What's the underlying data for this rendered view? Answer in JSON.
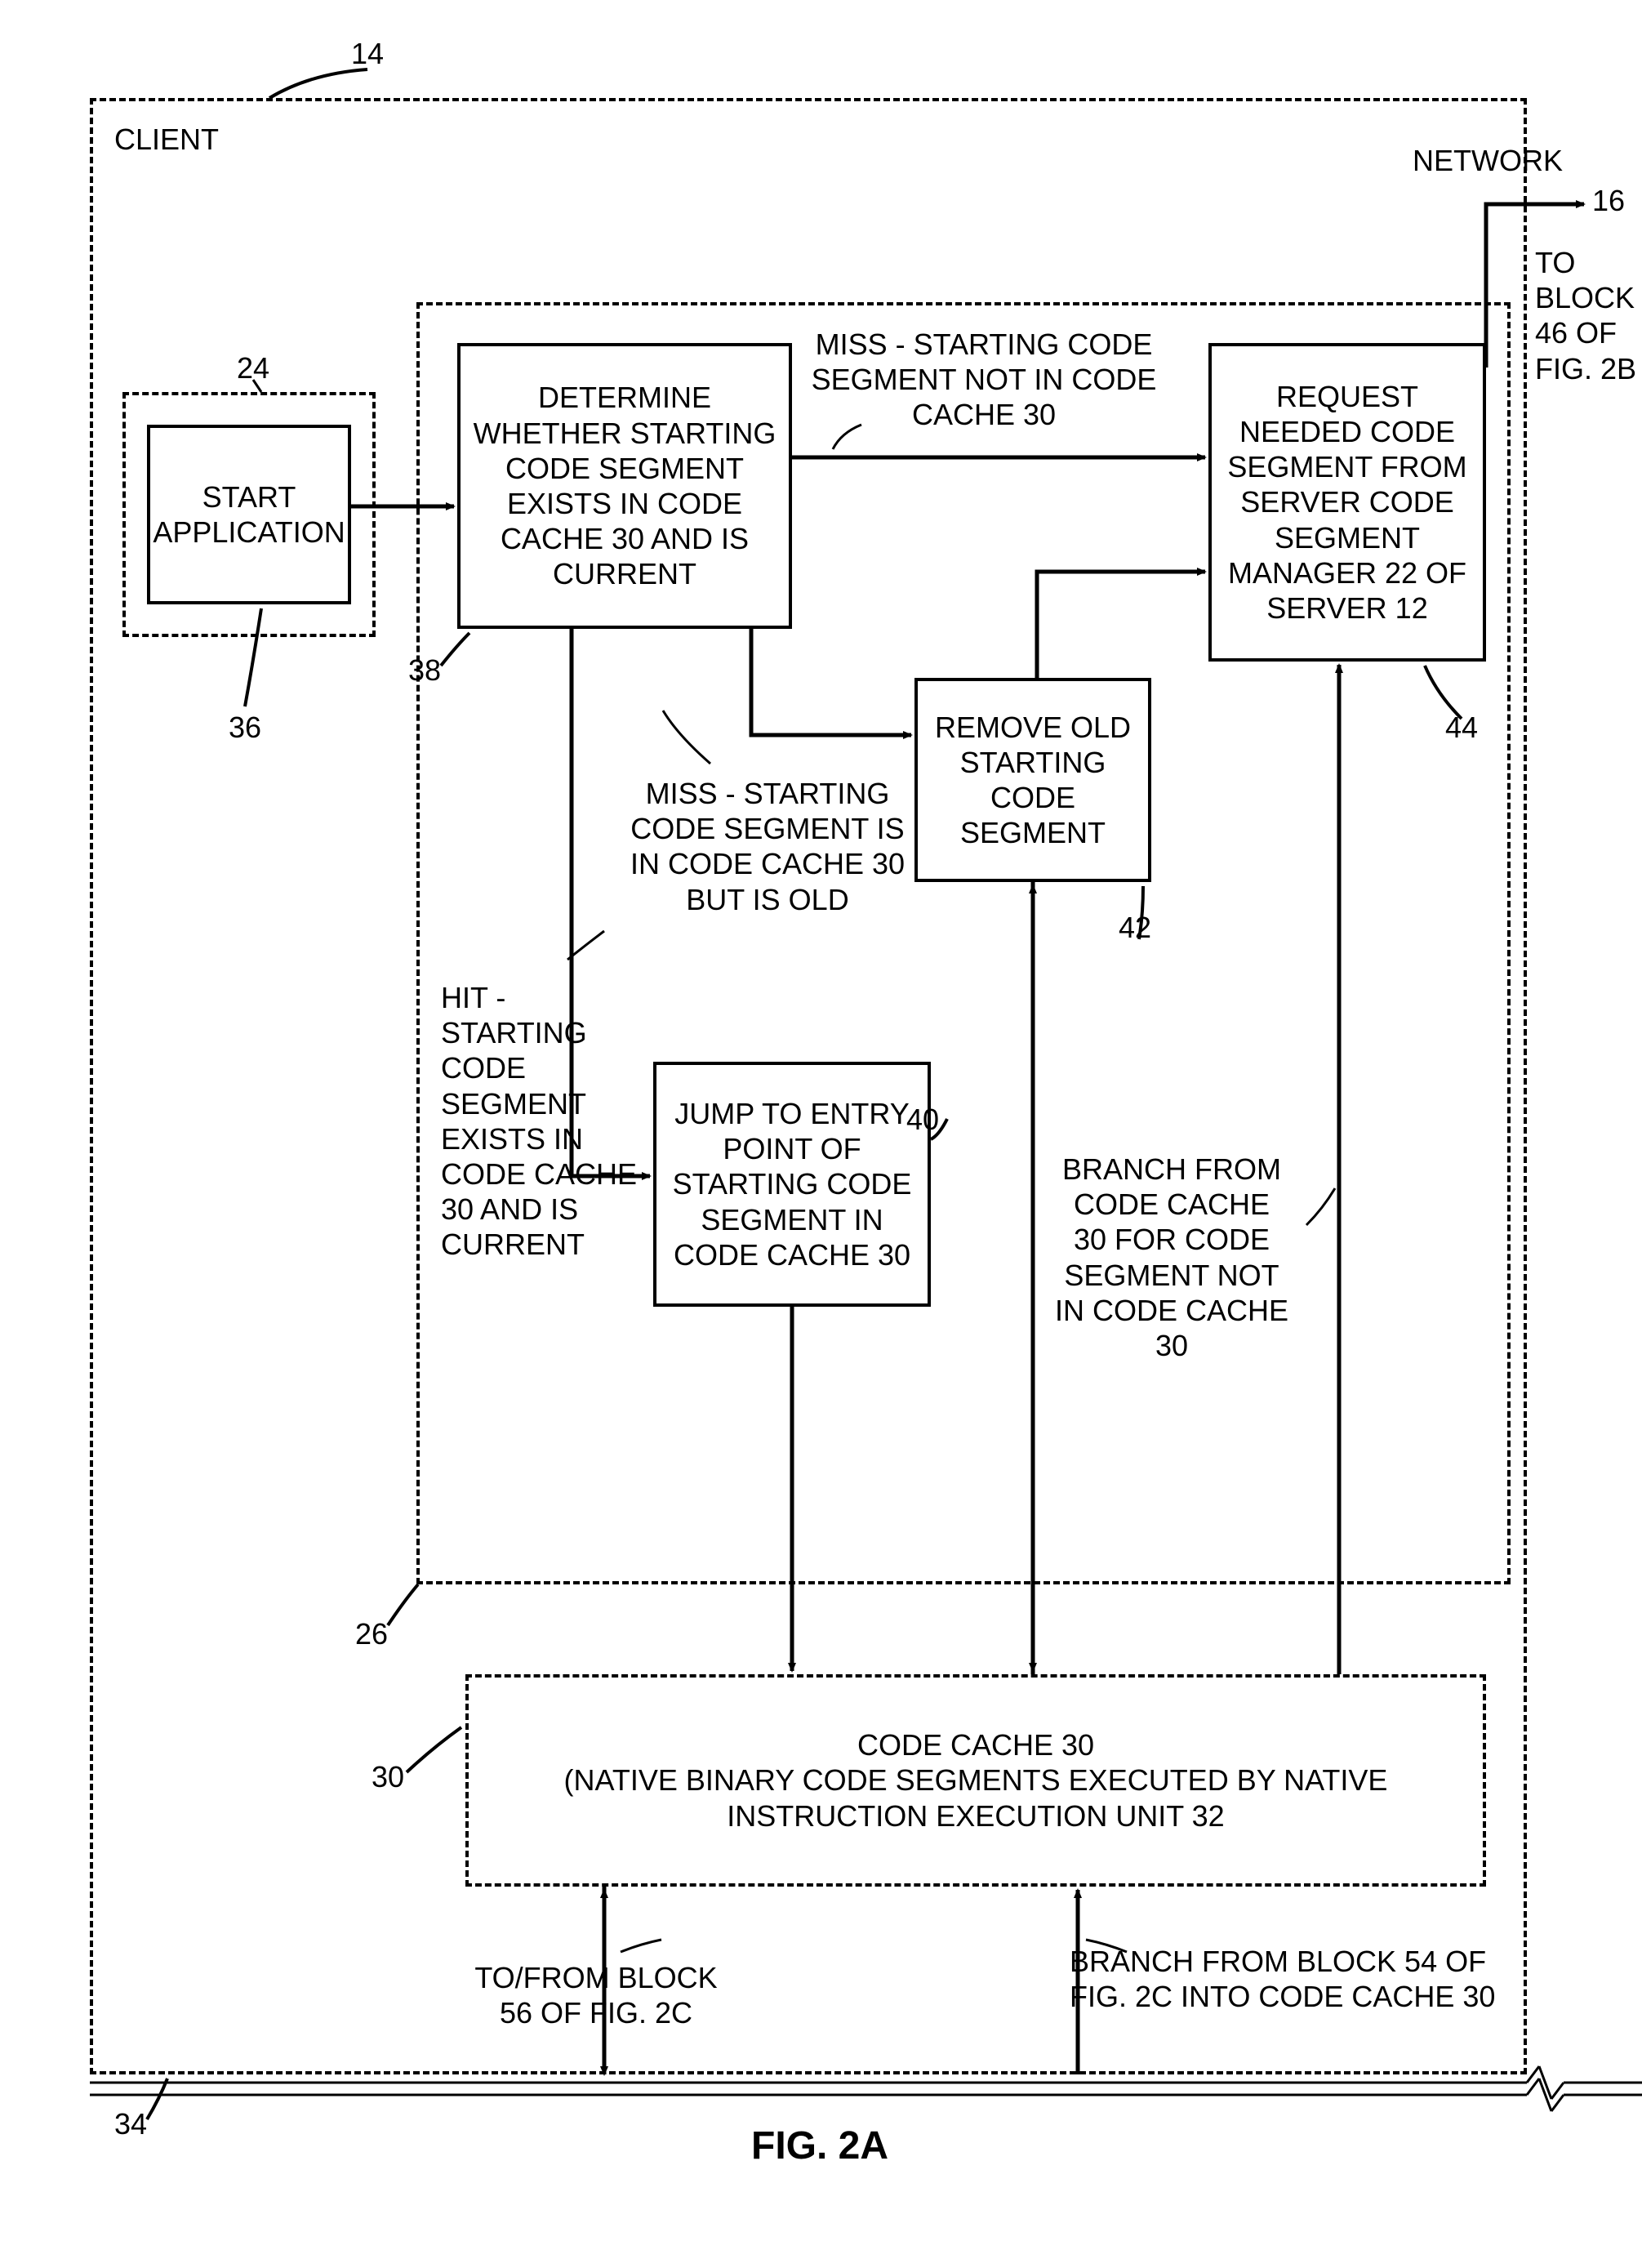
{
  "outer": {
    "title": "CLIENT",
    "ref": "14"
  },
  "startApp": {
    "text": "START\nAPPLICATION",
    "ref": "36",
    "containerRef": "24"
  },
  "mgrBox": {
    "ref": "26"
  },
  "determine": {
    "text": "DETERMINE WHETHER STARTING CODE SEGMENT EXISTS IN CODE CACHE 30 AND IS CURRENT",
    "ref": "38"
  },
  "request": {
    "text": "REQUEST NEEDED CODE SEGMENT FROM SERVER CODE SEGMENT MANAGER 22 OF SERVER 12",
    "ref": "44"
  },
  "remove": {
    "text": "REMOVE OLD STARTING CODE SEGMENT",
    "ref": "42"
  },
  "jump": {
    "text": "JUMP TO ENTRY POINT OF STARTING CODE SEGMENT IN CODE CACHE 30",
    "ref": "40"
  },
  "cache": {
    "text": "CODE CACHE 30\n(NATIVE BINARY CODE SEGMENTS EXECUTED BY NATIVE INSTRUCTION EXECUTION UNIT 32",
    "ref": "30"
  },
  "edges": {
    "missNotIn": "MISS - STARTING CODE SEGMENT NOT IN CODE CACHE 30",
    "missOld": "MISS - STARTING CODE SEGMENT IS IN CODE CACHE 30 BUT IS OLD",
    "hit": "HIT - STARTING CODE SEGMENT EXISTS IN CODE CACHE 30 AND IS CURRENT",
    "branchNotIn": "BRANCH FROM CODE CACHE 30 FOR CODE SEGMENT NOT IN CODE CACHE 30"
  },
  "external": {
    "network": "NETWORK",
    "networkRef": "16",
    "toBlock46": "TO BLOCK\n46 OF\nFIG. 2B",
    "branchFrom54": "BRANCH FROM BLOCK 54 OF\nFIG. 2C INTO CODE CACHE 30",
    "toFrom56": "TO/FROM BLOCK\n56 OF FIG. 2C",
    "bottomRef": "34"
  },
  "figLabel": "FIG. 2A"
}
